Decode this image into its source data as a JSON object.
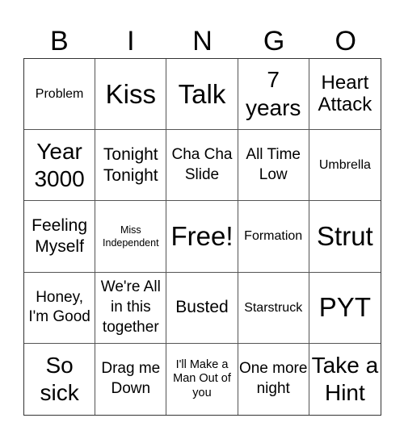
{
  "title_letters": [
    "B",
    "I",
    "N",
    "G",
    "O"
  ],
  "rows": [
    [
      {
        "text": "Problem",
        "size": "fs-xs"
      },
      {
        "text": "Kiss",
        "size": "fs-xl"
      },
      {
        "text": "Talk",
        "size": "fs-xl"
      },
      {
        "text": "7 years",
        "size": "fs-lg"
      },
      {
        "text": "Heart Attack",
        "size": "fs-md2"
      }
    ],
    [
      {
        "text": "Year 3000",
        "size": "fs-lg"
      },
      {
        "text": "Tonight Tonight",
        "size": "fs-md"
      },
      {
        "text": "Cha Cha Slide",
        "size": "fs-sm"
      },
      {
        "text": "All Time Low",
        "size": "fs-sm"
      },
      {
        "text": "Umbrella",
        "size": "fs-xs"
      }
    ],
    [
      {
        "text": "Feeling Myself",
        "size": "fs-md"
      },
      {
        "text": "Miss Independent",
        "size": "fs-tiny"
      },
      {
        "text": "Free!",
        "size": "fs-xl"
      },
      {
        "text": "Formation",
        "size": "fs-xs"
      },
      {
        "text": "Strut",
        "size": "fs-xl"
      }
    ],
    [
      {
        "text": "Honey, I'm Good",
        "size": "fs-sm"
      },
      {
        "text": "We're All in this together",
        "size": "fs-sm"
      },
      {
        "text": "Busted",
        "size": "fs-md"
      },
      {
        "text": "Starstruck",
        "size": "fs-xs"
      },
      {
        "text": "PYT",
        "size": "fs-xl"
      }
    ],
    [
      {
        "text": "So sick",
        "size": "fs-lg"
      },
      {
        "text": "Drag me Down",
        "size": "fs-sm"
      },
      {
        "text": "I'll Make a Man Out of you",
        "size": "fs-xxs"
      },
      {
        "text": "One more night",
        "size": "fs-sm"
      },
      {
        "text": "Take a Hint",
        "size": "fs-lg"
      }
    ]
  ]
}
